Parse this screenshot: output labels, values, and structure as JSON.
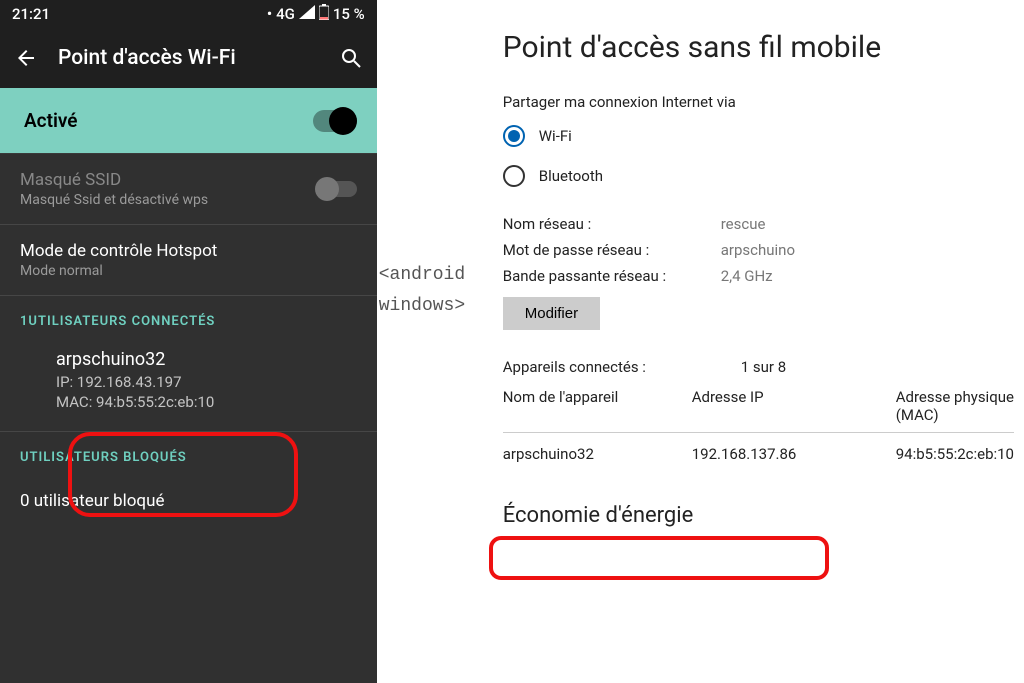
{
  "phone": {
    "statusbar": {
      "time": "21:21",
      "network": "4G",
      "battery": "15 %"
    },
    "title": "Point d'accès Wi-Fi",
    "enabled": {
      "label": "Activé"
    },
    "hiddenSsid": {
      "label": "Masqué SSID",
      "sub": "Masqué Ssid et désactivé wps"
    },
    "mode": {
      "label": "Mode de contrôle Hotspot",
      "sub": "Mode normal"
    },
    "sectionConnected": "1UTILISATEURS CONNECTÉS",
    "device": {
      "name": "arpschuino32",
      "ip": "IP: 192.168.43.197",
      "mac": "MAC: 94:b5:55:2c:eb:10"
    },
    "sectionBlocked": "UTILISATEURS BLOQUÉS",
    "blocked": "0 utilisateur bloqué"
  },
  "annotation": {
    "line1": "<android",
    "line2": "windows>"
  },
  "win": {
    "title": "Point d'accès sans fil mobile",
    "shareVia": "Partager ma connexion Internet via",
    "option1": "Wi-Fi",
    "option2": "Bluetooth",
    "kv": {
      "netNameK": "Nom réseau :",
      "netNameV": "rescue",
      "netPassK": "Mot de passe réseau :",
      "netPassV": "arpschuino",
      "bandK": "Bande passante réseau :",
      "bandV": "2,4 GHz"
    },
    "modify": "Modifier",
    "connected": {
      "label": "Appareils connectés :",
      "value": "1 sur 8"
    },
    "headers": {
      "name": "Nom de l'appareil",
      "ip": "Adresse IP",
      "mac": "Adresse physique (MAC)"
    },
    "row": {
      "name": "arpschuino32",
      "ip": "192.168.137.86",
      "mac": "94:b5:55:2c:eb:10"
    },
    "energy": "Économie d'énergie"
  }
}
